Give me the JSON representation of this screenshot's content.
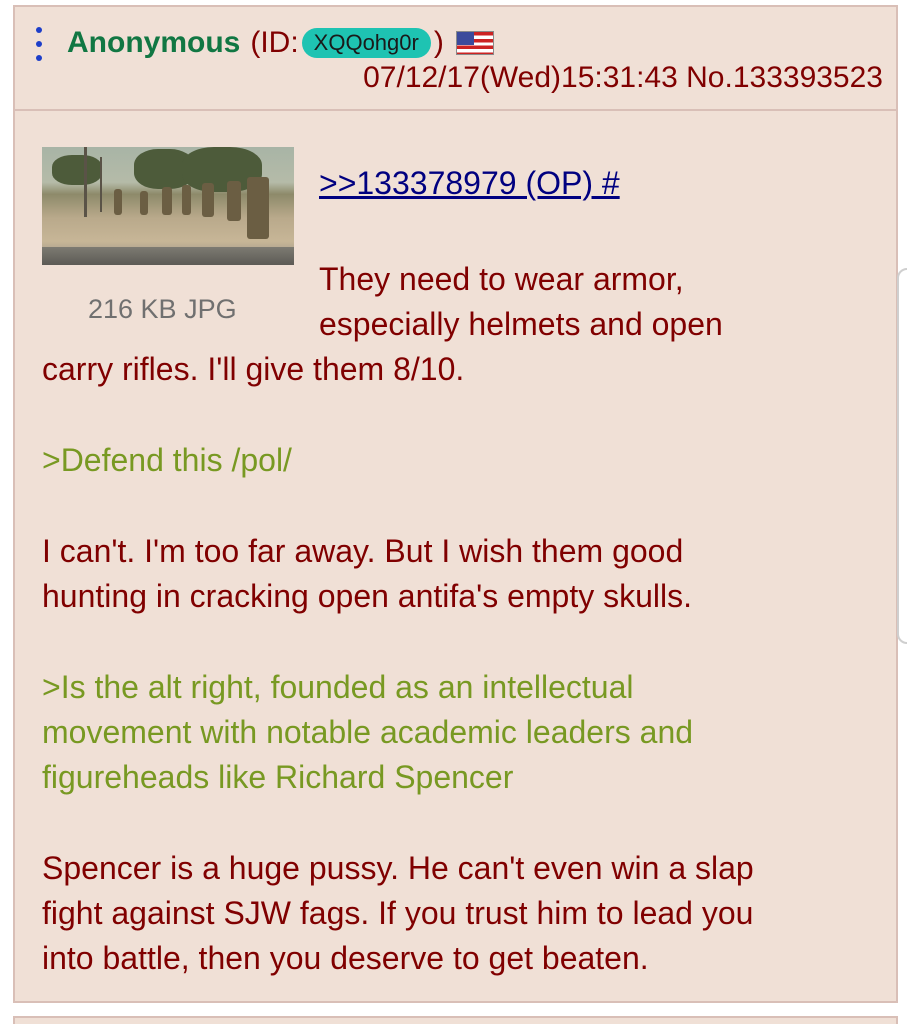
{
  "post": {
    "name": "Anonymous",
    "id_prefix": "(ID:",
    "id": "XQQohg0r",
    "id_suffix": ")",
    "flag_icon": "us-flag-icon",
    "date": "07/12/17(Wed)15:31:43",
    "number": "No.133393523",
    "file": {
      "info": "216 KB JPG"
    },
    "quotelink": ">>133378979 (OP) #",
    "lines": [
      {
        "text": "They need to wear armor,",
        "type": "normal"
      },
      {
        "text": "especially helmets and open",
        "type": "normal"
      },
      {
        "text": "carry rifles. I'll give them 8/10.",
        "type": "normal"
      },
      {
        "text": ">Defend this /pol/",
        "type": "greentext"
      },
      {
        "text": "I can't. I'm too far away. But I wish them good",
        "type": "normal"
      },
      {
        "text": "hunting in cracking open antifa's empty skulls.",
        "type": "normal"
      },
      {
        "text": ">Is the alt right, founded as an intellectual",
        "type": "greentext"
      },
      {
        "text": "movement with notable academic leaders and",
        "type": "greentext"
      },
      {
        "text": "figureheads like Richard Spencer",
        "type": "greentext"
      },
      {
        "text": "Spencer is a huge pussy. He can't even win a slap",
        "type": "normal"
      },
      {
        "text": "fight against SJW fags. If you trust him to lead you",
        "type": "normal"
      },
      {
        "text": "into battle, then you deserve to get beaten.",
        "type": "normal"
      }
    ]
  },
  "colors": {
    "post_background": "#f0e0d6",
    "post_border": "#d9bfb7",
    "name": "#117743",
    "text": "#800000",
    "greentext": "#789922",
    "quotelink": "#000080",
    "id_badge": "#1ec3b2",
    "menu_dots": "#1d3ec9"
  }
}
